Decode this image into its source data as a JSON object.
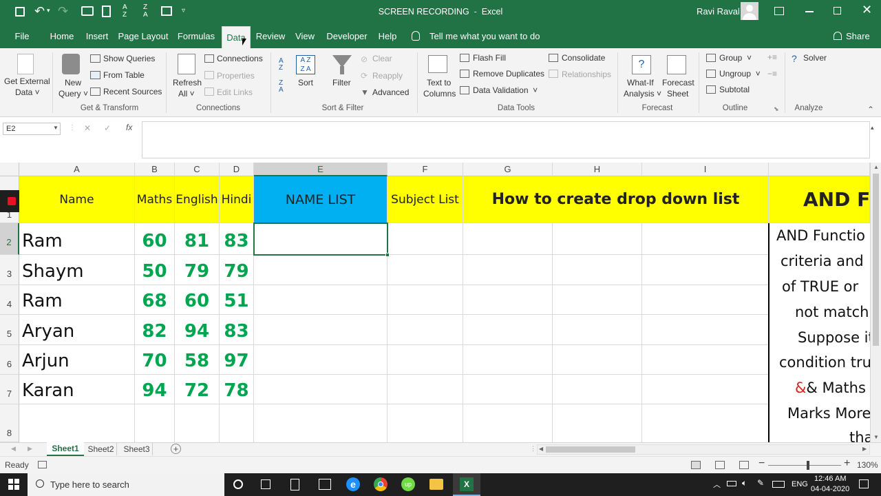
{
  "titlebar": {
    "title": "SCREEN RECORDING  -  Excel",
    "user": "Ravi Raval"
  },
  "tabs": [
    "File",
    "Home",
    "Insert",
    "Page Layout",
    "Formulas",
    "Data",
    "Review",
    "View",
    "Developer",
    "Help"
  ],
  "tell_me": "Tell me what you want to do",
  "share": "Share",
  "ribbon": {
    "get_external": [
      "Get External",
      "Data ˅"
    ],
    "new_query": [
      "New",
      "Query ˅"
    ],
    "show_queries": "Show Queries",
    "from_table": "From Table",
    "recent_sources": "Recent Sources",
    "refresh_all": [
      "Refresh",
      "All ˅"
    ],
    "connections": "Connections",
    "properties": "Properties",
    "edit_links": "Edit Links",
    "sort": "Sort",
    "filter": "Filter",
    "clear": "Clear",
    "reapply": "Reapply",
    "advanced": "Advanced",
    "text_to_columns": [
      "Text to",
      "Columns"
    ],
    "flash_fill": "Flash Fill",
    "remove_duplicates": "Remove Duplicates",
    "data_validation": "Data Validation  ˅",
    "consolidate": "Consolidate",
    "relationships": "Relationships",
    "what_if": [
      "What-If",
      "Analysis ˅"
    ],
    "forecast_sheet": [
      "Forecast",
      "Sheet"
    ],
    "group": "Group  ˅",
    "ungroup": "Ungroup  ˅",
    "subtotal": "Subtotal",
    "solver": "Solver",
    "groups": {
      "get_transform": "Get & Transform",
      "connections": "Connections",
      "sort_filter": "Sort & Filter",
      "data_tools": "Data Tools",
      "forecast": "Forecast",
      "outline": "Outline",
      "analyze": "Analyze"
    }
  },
  "namebox": "E2",
  "fx": "fx",
  "columns": [
    "A",
    "B",
    "C",
    "D",
    "E",
    "F",
    "G",
    "H",
    "I"
  ],
  "rows": [
    "1",
    "2",
    "3",
    "4",
    "5",
    "6",
    "7",
    "8"
  ],
  "header_row": {
    "name": "Name",
    "maths": "Maths",
    "english": "English",
    "hindi": "Hindi",
    "name_list": "NAME LIST",
    "subject_list": "Subject List",
    "how_to": "How to create drop down list",
    "and_f": "AND F"
  },
  "data_rows": [
    {
      "name": "Ram",
      "maths": "60",
      "english": "81",
      "hindi": "83"
    },
    {
      "name": "Shaym",
      "maths": "50",
      "english": "79",
      "hindi": "79"
    },
    {
      "name": "Ram",
      "maths": "68",
      "english": "60",
      "hindi": "51"
    },
    {
      "name": "Aryan",
      "maths": "82",
      "english": "94",
      "hindi": "83"
    },
    {
      "name": "Arjun",
      "maths": "70",
      "english": "58",
      "hindi": "97"
    },
    {
      "name": "Karan",
      "maths": "94",
      "english": "72",
      "hindi": "78"
    }
  ],
  "note_lines": [
    "AND Functio",
    "criteria and",
    "of TRUE or",
    "not match",
    "Suppose it",
    "condition tru",
    "& Maths M",
    "Marks More",
    "thar"
  ],
  "sheets": [
    "Sheet1",
    "Sheet2",
    "Sheet3"
  ],
  "status": {
    "ready": "Ready",
    "zoom": "130%"
  },
  "taskbar": {
    "search": "Type here to search",
    "lang": "ENG",
    "time": "12:46 AM",
    "date": "04-04-2020"
  },
  "colors": {
    "excel_green": "#217346",
    "yellow": "#ffff00",
    "blue": "#00b0f0",
    "number_green": "#00a550"
  }
}
